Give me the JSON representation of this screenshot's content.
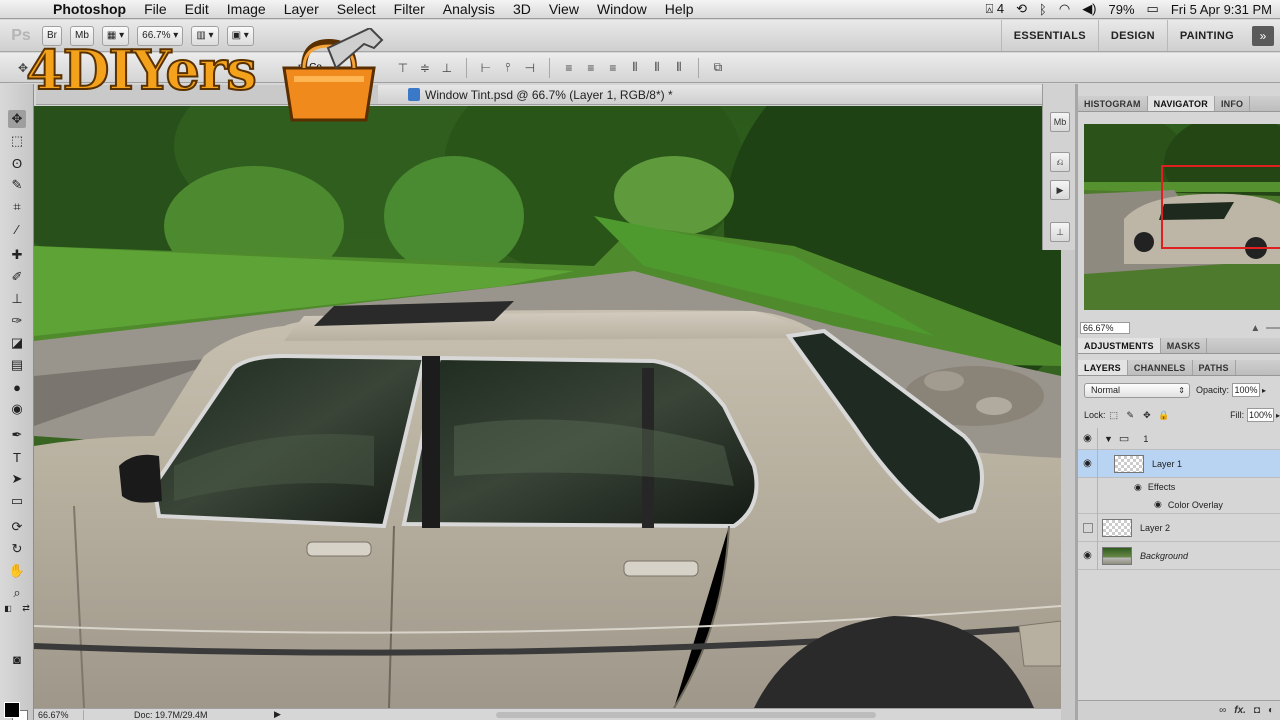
{
  "menubar": {
    "apple": "",
    "items": [
      "Photoshop",
      "File",
      "Edit",
      "Image",
      "Layer",
      "Select",
      "Filter",
      "Analysis",
      "3D",
      "View",
      "Window",
      "Help"
    ],
    "status": {
      "adobe_badge": "4",
      "battery": "79%",
      "datetime": "Fri 5 Apr  9:31 PM"
    }
  },
  "appbar": {
    "ps_logo": "Ps",
    "bridge_label": "Br",
    "mini_bridge_label": "Mb",
    "zoom_label": "66.7%",
    "workspaces": [
      "ESSENTIALS",
      "DESIGN",
      "PAINTING"
    ],
    "more_label": "»"
  },
  "options": {
    "partial_label": "m Co"
  },
  "logo": {
    "brand": "4DIYers"
  },
  "document": {
    "title": "Window Tint.psd @ 66.7% (Layer 1, RGB/8*) *"
  },
  "status": {
    "zoom": "66.67%",
    "doc": "Doc: 19.7M/29.4M"
  },
  "dock": {
    "mb_label": "Mb"
  },
  "navigator": {
    "tabs": [
      "HISTOGRAM",
      "NAVIGATOR",
      "INFO"
    ],
    "active_tab": "NAVIGATOR",
    "zoom_value": "66.67%"
  },
  "adjustments": {
    "tabs": [
      "ADJUSTMENTS",
      "MASKS"
    ],
    "active_tab": "ADJUSTMENTS"
  },
  "layers_panel": {
    "tabs": [
      "LAYERS",
      "CHANNELS",
      "PATHS"
    ],
    "active_tab": "LAYERS",
    "blend_mode": "Normal",
    "opacity_label": "Opacity:",
    "opacity_value": "100%",
    "lock_label": "Lock:",
    "fill_label": "Fill:",
    "fill_value": "100%",
    "layers": [
      {
        "name": "1",
        "type": "group",
        "visible": true
      },
      {
        "name": "Layer 1",
        "type": "layer",
        "visible": true,
        "selected": true
      },
      {
        "name": "Effects",
        "type": "effects"
      },
      {
        "name": "Color Overlay",
        "type": "effect"
      },
      {
        "name": "Layer 2",
        "type": "layer",
        "visible": false
      },
      {
        "name": "Background",
        "type": "background",
        "visible": true
      }
    ],
    "footer_fx": "fx."
  },
  "colors": {
    "accent_selection": "#b9d3f2",
    "logo_orange": "#f4a21c",
    "nav_view_box": "#e02020"
  }
}
